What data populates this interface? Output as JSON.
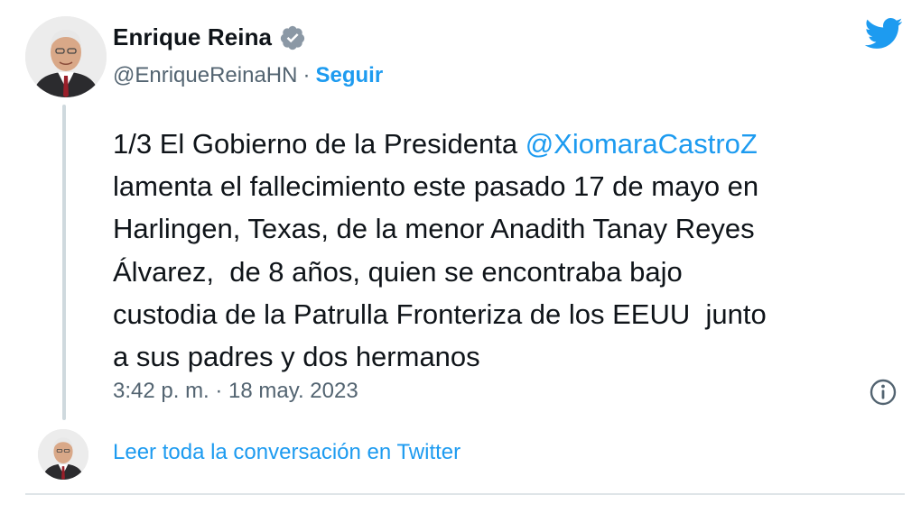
{
  "author": {
    "name": "Enrique Reina",
    "handle": "@EnriqueReinaHN",
    "separator": "·",
    "follow_label": "Seguir",
    "verified": true
  },
  "tweet": {
    "text_lines": [
      {
        "before": "1/3 El Gobierno de la Presidenta ",
        "mention": "@XiomaraCastroZ",
        "after": ""
      },
      {
        "before": "lamenta el fallecimiento este pasado 17 de mayo en"
      },
      {
        "before": "Harlingen, Texas, de la menor Anadith Tanay Reyes"
      },
      {
        "before": "Álvarez,  de 8 años, quien se encontraba bajo"
      },
      {
        "before": "custodia de la Patrulla Fronteriza de los EEUU  junto"
      },
      {
        "before": "a sus padres y dos hermanos"
      }
    ],
    "timestamp": "3:42 p. m. · 18 may. 2023"
  },
  "footer": {
    "read_conversation": "Leer toda la conversación en Twitter"
  },
  "colors": {
    "accent": "#1d9bf0",
    "text": "#0f1419",
    "muted": "#536471",
    "thread_line": "#cfd9de"
  },
  "icons": {
    "brand": "twitter-bird-icon",
    "verified": "verified-badge-icon",
    "info": "info-icon"
  }
}
